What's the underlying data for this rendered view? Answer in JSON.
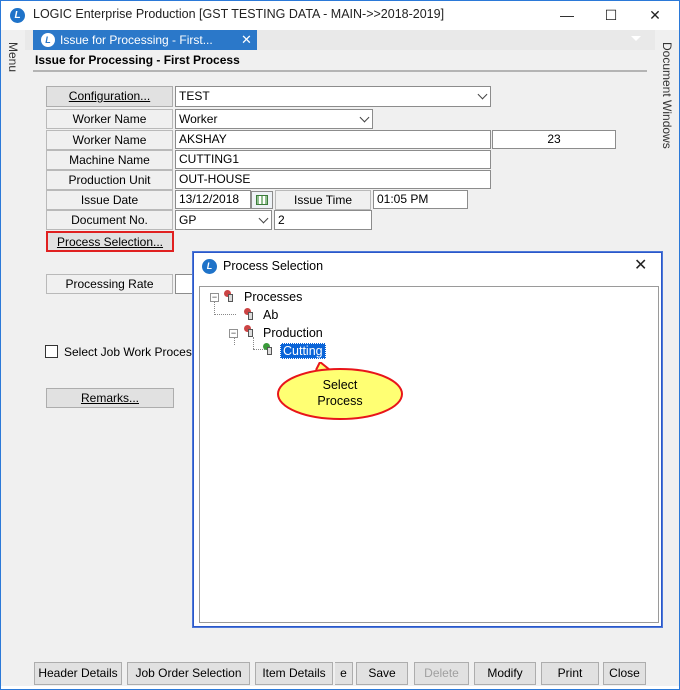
{
  "window": {
    "title": "LOGIC Enterprise Production  [GST TESTING DATA - MAIN->>2018-2019]",
    "minimize": "—",
    "maximize": "☐",
    "close": "✕"
  },
  "sidebars": {
    "left": "Menu",
    "right": "Document Windows"
  },
  "tab": {
    "label": "Issue for Processing - First...",
    "close": "✕"
  },
  "form": {
    "title": "Issue for Processing - First Process",
    "configuration_button": "Configuration...",
    "configuration_value": "TEST",
    "worker_type_label": "Worker Name",
    "worker_type_value": "Worker",
    "worker_name_label": "Worker Name",
    "worker_name_value": "AKSHAY",
    "worker_code": "23",
    "machine_label": "Machine Name",
    "machine_value": "CUTTING1",
    "unit_label": "Production Unit",
    "unit_value": "OUT-HOUSE",
    "issue_date_label": "Issue Date",
    "issue_date_value": "13/12/2018",
    "issue_time_label": "Issue Time",
    "issue_time_value": "01:05 PM",
    "doc_no_label": "Document No.",
    "doc_prefix": "GP",
    "doc_number": "2",
    "process_selection_button": "Process Selection...",
    "processing_rate_label": "Processing Rate",
    "job_work_checkbox": "Select Job Work Processes",
    "remarks_button": "Remarks..."
  },
  "bottom_buttons": {
    "header_details": "Header Details",
    "job_order_selection": "Job Order Selection",
    "item_details": "Item Details",
    "hidden_partial": "e",
    "save": "Save",
    "delete": "Delete",
    "modify": "Modify",
    "print": "Print",
    "close": "Close"
  },
  "dialog": {
    "title": "Process Selection",
    "close": "✕",
    "tree": {
      "root": "Processes",
      "child_ab": "Ab",
      "child_production": "Production",
      "grandchild_cutting": "Cutting"
    },
    "callout_line1": "Select",
    "callout_line2": "Process"
  }
}
